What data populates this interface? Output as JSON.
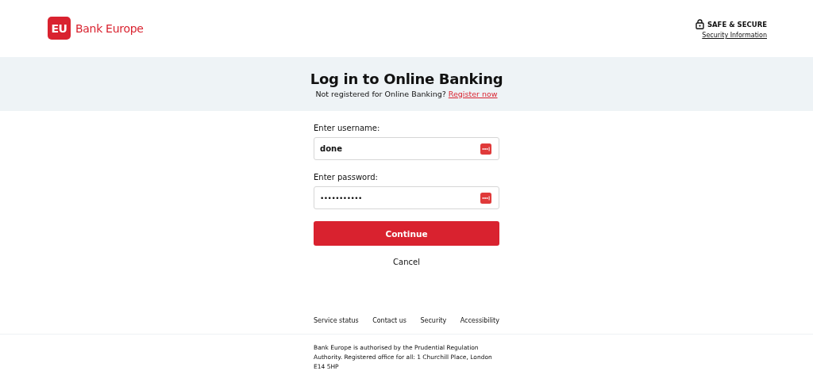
{
  "header": {
    "logo_mark": "EU",
    "logo_text": "Bank Europe",
    "secure_label": "SAFE & SECURE",
    "security_link": "Security Information"
  },
  "banner": {
    "title": "Log in to Online Banking",
    "subtitle": "Not registered for Online Banking?",
    "register_link": "Register now"
  },
  "form": {
    "fields": [
      {
        "label": "Enter username:",
        "value": "done"
      },
      {
        "label": "Enter password:",
        "value": "•••••••••••"
      }
    ],
    "continue_button": "Continue",
    "cancel_link": "Cancel"
  },
  "footer": {
    "links": [
      "Service status",
      "Contact us",
      "Security",
      "Accessibility"
    ],
    "legal": "Bank Europe is authorised by the Prudential Regulation Authority. Registered office for all: 1 Churchill Place, London E14 5HP"
  }
}
